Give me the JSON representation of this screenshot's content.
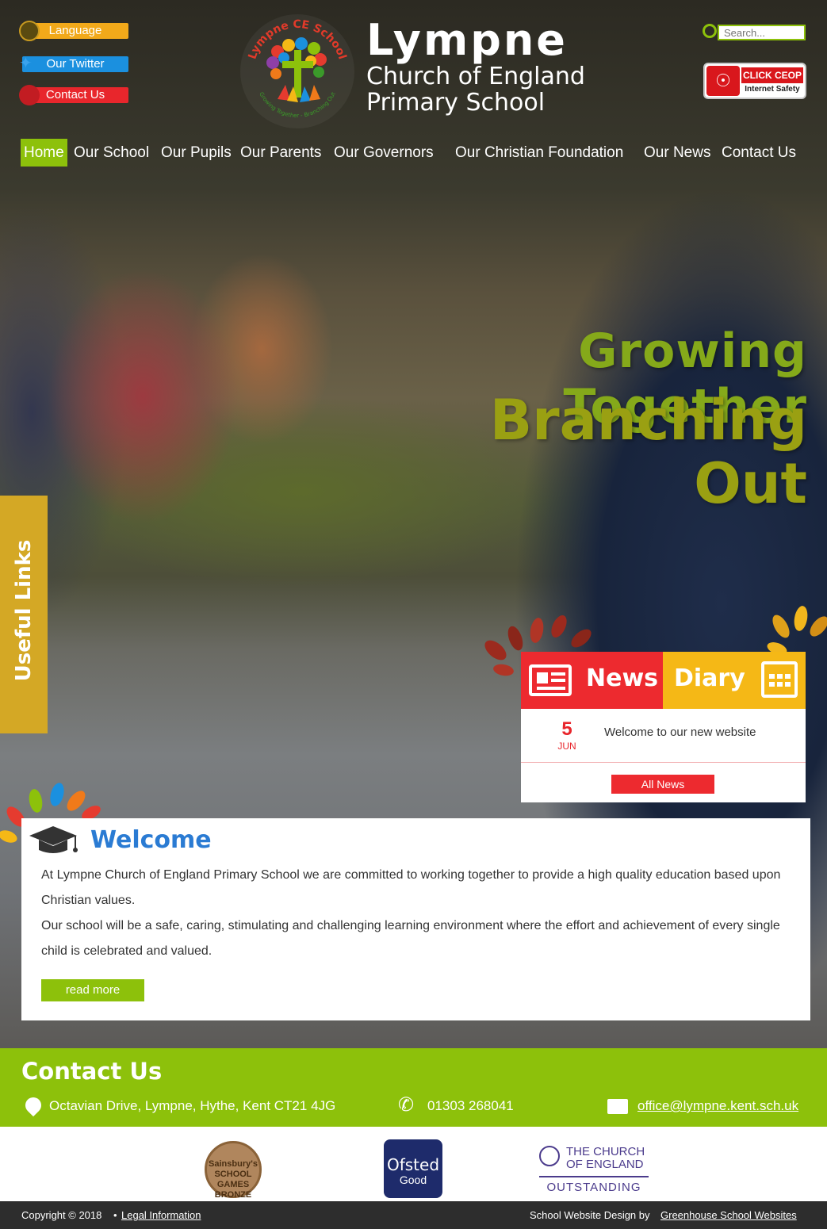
{
  "header": {
    "top_links": {
      "language": "Language",
      "twitter": "Our Twitter",
      "contact": "Contact Us"
    },
    "logo_text": "Lympne CE School",
    "logo_motto": "Growing Together - Branching Out",
    "brand_name": "Lympne",
    "brand_line1": "Church of England",
    "brand_line2": "Primary School",
    "search_placeholder": "Search...",
    "ceop": {
      "line1": "CLICK CEOP",
      "line2": "Internet Safety"
    }
  },
  "nav": {
    "items": [
      "Home",
      "Our School",
      "Our Pupils",
      "Our Parents",
      "Our Governors",
      "Our Christian Foundation",
      "Our News",
      "Contact Us"
    ]
  },
  "hero": {
    "tagline1": "Growing Together",
    "tagline2": "Branching Out"
  },
  "sidebar": {
    "useful_links": "Useful Links"
  },
  "news_widget": {
    "tab_news": "News",
    "tab_diary": "Diary",
    "items": [
      {
        "day": "5",
        "month": "JUN",
        "title": "Welcome to our new website"
      }
    ],
    "all_news": "All News"
  },
  "welcome": {
    "title": "Welcome",
    "para1": "At Lympne Church of England Primary School we are committed to working together to provide a high quality education based upon Christian values.",
    "para2": "Our school will be a safe, caring, stimulating and challenging learning environment where the effort and achievement of every single child is celebrated and valued.",
    "read_more": "read more"
  },
  "contact": {
    "title": "Contact Us",
    "address": "Octavian Drive, Lympne, Hythe, Kent CT21 4JG",
    "phone": "01303 268041",
    "email": "office@lympne.kent.sch.uk"
  },
  "logos": {
    "games": {
      "l1": "Sainsbury's",
      "l2": "SCHOOL GAMES",
      "l3": "BRONZE"
    },
    "ofsted": {
      "l1": "Ofsted",
      "l2": "Good"
    },
    "coe": {
      "l1": "THE CHURCH",
      "l2": "OF ENGLAND",
      "l3": "OUTSTANDING"
    }
  },
  "footer": {
    "copyright": "Copyright © 2018",
    "legal": "Legal Information",
    "design_prefix": "School Website Design by",
    "design_link": "Greenhouse School Websites"
  },
  "colors": {
    "green": "#8dc10b",
    "news_red": "#ed2a2f",
    "diary_yellow": "#f5b816",
    "welcome_blue": "#2a7bd3",
    "useful_gold": "#d4a825"
  }
}
